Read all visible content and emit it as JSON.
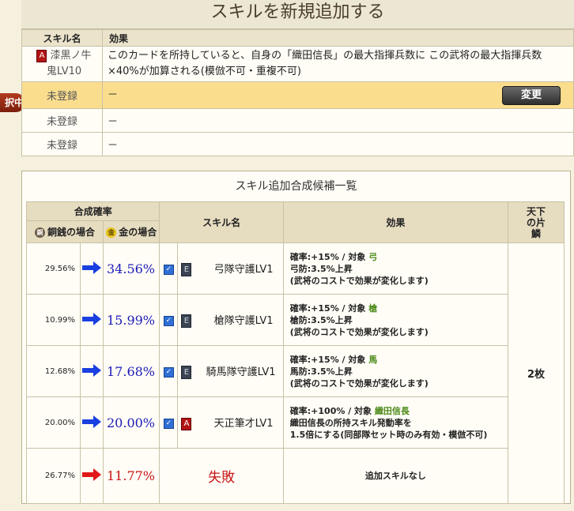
{
  "page_title": "スキルを新規追加する",
  "selected_tab": "択中",
  "skills_table": {
    "headers": {
      "name": "スキル名",
      "effect": "効果"
    },
    "owned": {
      "badge": "A",
      "name_line1": "漆黒ノ牛",
      "name_line2": "鬼LV10",
      "effect": "このカードを所持していると、自身の「織田信長」の最大指揮兵数に この武将の最大指揮兵数×40%が加算される(模倣不可・重複不可)"
    },
    "slots": [
      {
        "name": "未登録",
        "effect": "－",
        "button": "変更"
      },
      {
        "name": "未登録",
        "effect": "－"
      },
      {
        "name": "未登録",
        "effect": "－"
      }
    ]
  },
  "candidates": {
    "title": "スキル追加合成候補一覧",
    "headers": {
      "rate": "合成確率",
      "copper": "銅銭の場合",
      "gold": "金の場合",
      "skill": "スキル名",
      "effect": "効果",
      "fragment": "天下の片鱗",
      "copper_coin": "銅",
      "gold_coin": "金"
    },
    "fragment_value": "2枚",
    "rows": [
      {
        "copper": "29.56%",
        "gold": "34.56%",
        "badge": "E",
        "skill": "弓隊守護LV1",
        "eff1": "確率:+15% / 対象",
        "target": "弓",
        "eff2": "弓防:3.5%上昇",
        "eff3": "(武将のコストで効果が変化します)"
      },
      {
        "copper": "10.99%",
        "gold": "15.99%",
        "badge": "E",
        "skill": "槍隊守護LV1",
        "eff1": "確率:+15% / 対象",
        "target": "槍",
        "eff2": "槍防:3.5%上昇",
        "eff3": "(武将のコストで効果が変化します)"
      },
      {
        "copper": "12.68%",
        "gold": "17.68%",
        "badge": "E",
        "skill": "騎馬隊守護LV1",
        "eff1": "確率:+15% / 対象",
        "target": "馬",
        "eff2": "馬防:3.5%上昇",
        "eff3": "(武将のコストで効果が変化します)"
      },
      {
        "copper": "20.00%",
        "gold": "20.00%",
        "badge": "A",
        "skill": "天正筆才LV1",
        "eff1": "確率:+100% / 対象",
        "target": "織田信長",
        "eff2": "織田信長の所持スキル発動率を",
        "eff3": "1.5倍にする(同部隊セット時のみ有効・模倣不可)"
      }
    ],
    "fail_row": {
      "copper": "26.77%",
      "gold": "11.77%",
      "skill": "失敗",
      "effect": "追加スキルなし"
    }
  },
  "colors": {
    "arrow_blue": "#1a3fe0",
    "arrow_red": "#e01818",
    "gold_text": "#1c1ab8",
    "fail_text": "#c81414"
  },
  "icons": {
    "arrow": "arrow-right-icon",
    "check": "checkbox-checked-icon"
  }
}
